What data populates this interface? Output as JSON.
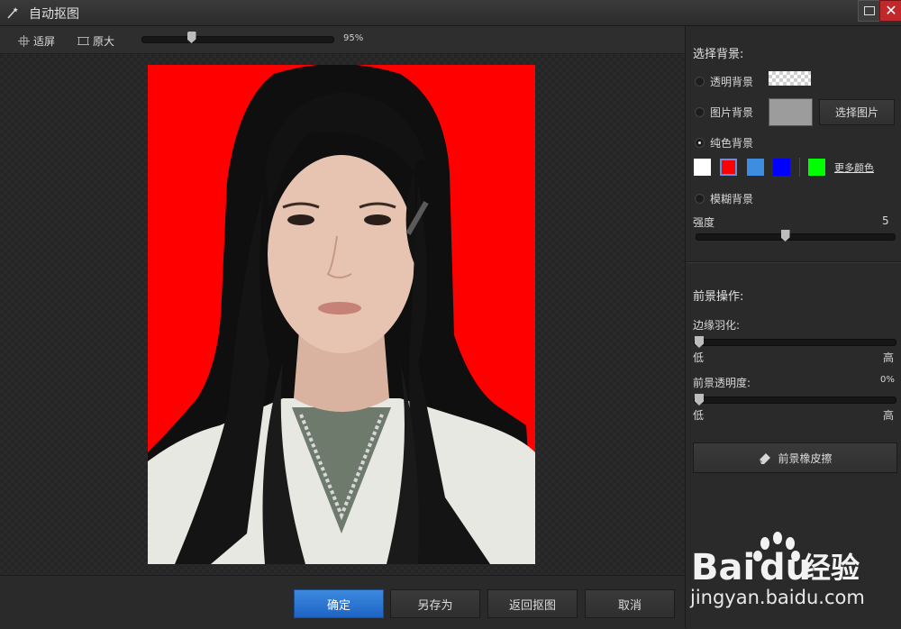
{
  "window": {
    "title": "自动抠图"
  },
  "toolbar": {
    "fit_label": "适屏",
    "original_label": "原大",
    "zoom_value": "95%",
    "zoom_level": 0.25
  },
  "footer": {
    "confirm_label": "确定",
    "save_as_label": "另存为",
    "back_label": "返回抠图",
    "cancel_label": "取消"
  },
  "panel": {
    "bg_title": "选择背景:",
    "transparent_label": "透明背景",
    "image_bg_label": "图片背景",
    "select_image_label": "选择图片",
    "solid_label": "纯色背景",
    "swatches": [
      "#ffffff",
      "#ff0000",
      "#3d8ee0",
      "#0000ff",
      "#00ff00"
    ],
    "more_colors_label": "更多颜色",
    "blur_label": "模糊背景",
    "strength_label": "强度",
    "strength_value": "5",
    "strength_level": 0.45,
    "fg_title": "前景操作:",
    "feather_label": "边缘羽化:",
    "low_label": "低",
    "high_label": "高",
    "feather_level": 0,
    "opacity_label": "前景透明度:",
    "opacity_value": "0%",
    "opacity_level": 0,
    "eraser_label": "前景橡皮擦"
  },
  "watermark": {
    "brand": "Bai du 经验",
    "url": "jingyan.baidu.com"
  },
  "colors": {
    "photo_bg": "#ff0000",
    "accent": "#2a74d0",
    "close": "#c0282b"
  }
}
